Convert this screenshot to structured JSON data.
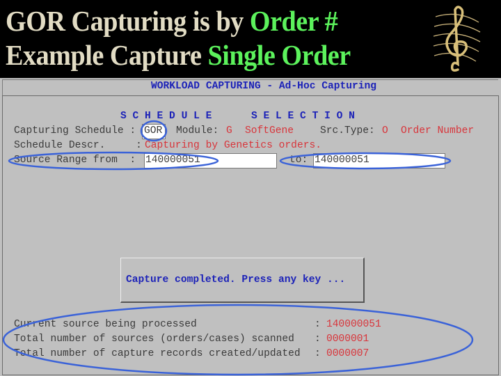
{
  "slide_title": {
    "line1_plain": "GOR Capturing is by ",
    "line1_highlight": "Order #",
    "line2_plain": "Example Capture ",
    "line2_highlight": "Single Order",
    "logo_icon": "treble-clef-icon"
  },
  "screen": {
    "header": "WORKLOAD CAPTURING - Ad-Hoc Capturing",
    "section_left": "S C H E D U L E",
    "section_right": "S E L E C T I O N",
    "capturing_schedule_label": "Capturing Schedule :",
    "capturing_schedule_value": "GOR",
    "module_label": "Module:",
    "module_code": "G",
    "module_name": "SoftGene",
    "src_type_label": "Src.Type:",
    "src_type_code": "O",
    "src_type_name": "Order Number",
    "descr_label": "Schedule Descr.     :",
    "descr_value": "Capturing by Genetics orders.",
    "range_from_label": "Source Range from  :",
    "range_from_value": "140000051",
    "range_to_label": "to:",
    "range_to_value": "140000051",
    "popup_message": "Capture completed. Press any key ...",
    "stats": [
      {
        "label": "Current source being processed",
        "value": "140000051"
      },
      {
        "label": "Total number of sources (orders/cases) scanned",
        "value": "0000001"
      },
      {
        "label": "Total number of capture records created/updated",
        "value": "0000007"
      }
    ]
  },
  "colors": {
    "highlight_green": "#5cf25c",
    "annotation_blue": "#3a62d8",
    "value_red": "#d8343a",
    "heading_blue": "#1c22b8"
  }
}
